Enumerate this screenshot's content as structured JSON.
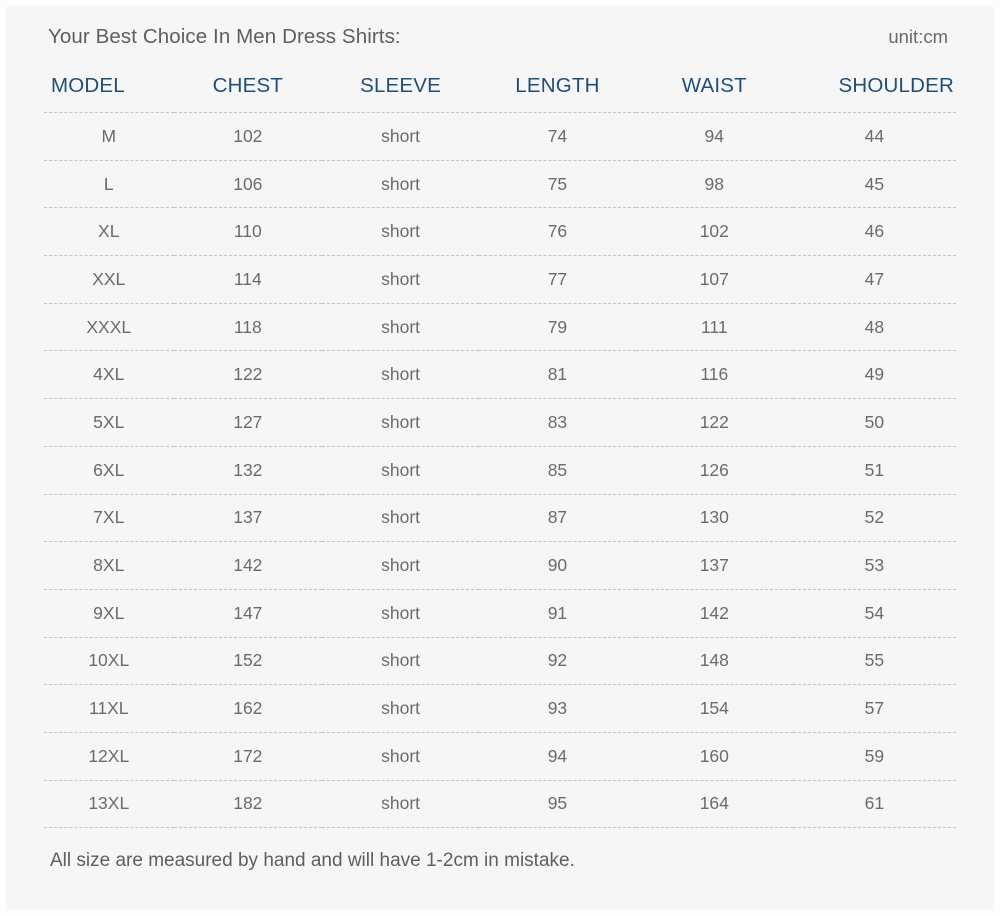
{
  "chart": {
    "title": "Your Best Choice In Men Dress Shirts:",
    "unit": "unit:cm",
    "footnote": "All size are measured by hand and will have 1-2cm in mistake.",
    "accent_color": "#1f4e79",
    "text_color": "#6b6b6b",
    "background_color": "#f6f6f6"
  },
  "chart_data": {
    "type": "table",
    "title": "Your Best Choice In Men Dress Shirts:",
    "columns": [
      "MODEL",
      "CHEST",
      "SLEEVE",
      "LENGTH",
      "WAIST",
      "SHOULDER"
    ],
    "rows": [
      [
        "M",
        "102",
        "short",
        "74",
        "94",
        "44"
      ],
      [
        "L",
        "106",
        "short",
        "75",
        "98",
        "45"
      ],
      [
        "XL",
        "110",
        "short",
        "76",
        "102",
        "46"
      ],
      [
        "XXL",
        "114",
        "short",
        "77",
        "107",
        "47"
      ],
      [
        "XXXL",
        "118",
        "short",
        "79",
        "111",
        "48"
      ],
      [
        "4XL",
        "122",
        "short",
        "81",
        "116",
        "49"
      ],
      [
        "5XL",
        "127",
        "short",
        "83",
        "122",
        "50"
      ],
      [
        "6XL",
        "132",
        "short",
        "85",
        "126",
        "51"
      ],
      [
        "7XL",
        "137",
        "short",
        "87",
        "130",
        "52"
      ],
      [
        "8XL",
        "142",
        "short",
        "90",
        "137",
        "53"
      ],
      [
        "9XL",
        "147",
        "short",
        "91",
        "142",
        "54"
      ],
      [
        "10XL",
        "152",
        "short",
        "92",
        "148",
        "55"
      ],
      [
        "11XL",
        "162",
        "short",
        "93",
        "154",
        "57"
      ],
      [
        "12XL",
        "172",
        "short",
        "94",
        "160",
        "59"
      ],
      [
        "13XL",
        "182",
        "short",
        "95",
        "164",
        "61"
      ]
    ],
    "unit": "cm",
    "note": "All size are measured by hand and will have 1-2cm in mistake."
  }
}
